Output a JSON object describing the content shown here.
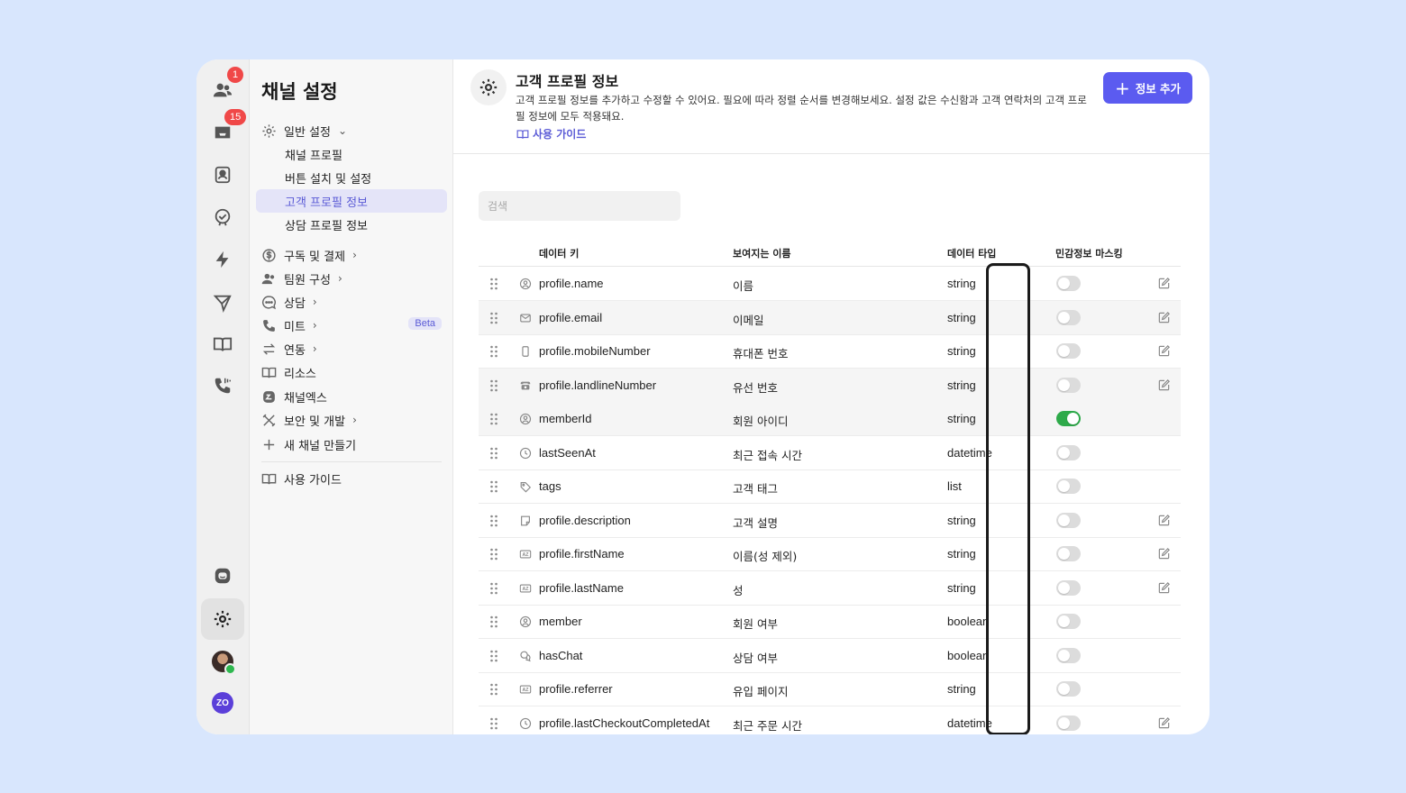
{
  "rail": {
    "badges": [
      "1",
      "15"
    ],
    "icons": [
      "team-icon",
      "inbox-icon",
      "contacts-icon",
      "check-badge-icon",
      "bolt-icon",
      "send-icon",
      "book-icon",
      "phone-icon",
      "bot-icon",
      "gear-icon",
      "avatar",
      "workspace-logo"
    ],
    "workspace_logo": "ZO"
  },
  "nav": {
    "title": "채널 설정",
    "general": "일반 설정",
    "sub_items": [
      "채널 프로필",
      "버튼 설치 및 설정",
      "고객 프로필 정보",
      "상담 프로필 정보"
    ],
    "selected": "고객 프로필 정보",
    "items": [
      "구독 및 결제",
      "팀원 구성",
      "상담",
      "미트",
      "연동",
      "리소스",
      "채널엑스",
      "보안 및 개발",
      "새 채널 만들기"
    ],
    "beta": "Beta",
    "guide": "사용 가이드"
  },
  "header": {
    "title": "고객 프로필 정보",
    "description": "고객 프로필 정보를 추가하고 수정할 수 있어요. 필요에 따라 정렬 순서를 변경해보세요. 설정 값은 수신함과 고객 연락처의 고객 프로필 정보에 모두 적용돼요.",
    "guide_link": "사용 가이드",
    "add_button": "정보 추가"
  },
  "search": {
    "placeholder": "검색"
  },
  "table": {
    "columns": [
      "데이터 키",
      "보여지는 이름",
      "데이터 타입",
      "민감정보 마스킹"
    ],
    "rows": [
      {
        "key": "profile.name",
        "display": "이름",
        "type": "string",
        "masked": false,
        "editable": true,
        "icon": "person-circle-icon"
      },
      {
        "key": "profile.email",
        "display": "이메일",
        "type": "string",
        "masked": false,
        "editable": true,
        "icon": "mail-icon"
      },
      {
        "key": "profile.mobileNumber",
        "display": "휴대폰 번호",
        "type": "string",
        "masked": false,
        "editable": true,
        "icon": "mobile-icon"
      },
      {
        "key": "profile.landlineNumber",
        "display": "유선 번호",
        "type": "string",
        "masked": false,
        "editable": true,
        "icon": "telephone-icon"
      },
      {
        "key": "memberId",
        "display": "회원 아이디",
        "type": "string",
        "masked": true,
        "editable": false,
        "icon": "person-circle-icon"
      },
      {
        "key": "lastSeenAt",
        "display": "최근 접속 시간",
        "type": "datetime",
        "masked": false,
        "editable": false,
        "icon": "clock-icon"
      },
      {
        "key": "tags",
        "display": "고객 태그",
        "type": "list",
        "masked": false,
        "editable": false,
        "icon": "tag-icon"
      },
      {
        "key": "profile.description",
        "display": "고객 설명",
        "type": "string",
        "masked": false,
        "editable": true,
        "icon": "note-icon"
      },
      {
        "key": "profile.firstName",
        "display": "이름(성 제외)",
        "type": "string",
        "masked": false,
        "editable": true,
        "icon": "text-type-icon"
      },
      {
        "key": "profile.lastName",
        "display": "성",
        "type": "string",
        "masked": false,
        "editable": true,
        "icon": "text-type-icon"
      },
      {
        "key": "member",
        "display": "회원 여부",
        "type": "boolean",
        "masked": false,
        "editable": false,
        "icon": "person-circle-icon"
      },
      {
        "key": "hasChat",
        "display": "상담 여부",
        "type": "boolean",
        "masked": false,
        "editable": false,
        "icon": "chat-icon"
      },
      {
        "key": "profile.referrer",
        "display": "유입 페이지",
        "type": "string",
        "masked": false,
        "editable": false,
        "icon": "text-type-icon"
      },
      {
        "key": "profile.lastCheckoutCompletedAt",
        "display": "최근 주문 시간",
        "type": "datetime",
        "masked": false,
        "editable": true,
        "icon": "clock-icon"
      }
    ]
  },
  "colors": {
    "accent": "#5b5bf0",
    "toggle_on": "#2eaa4a",
    "badge": "#f04848",
    "background": "#d8e6fd"
  }
}
